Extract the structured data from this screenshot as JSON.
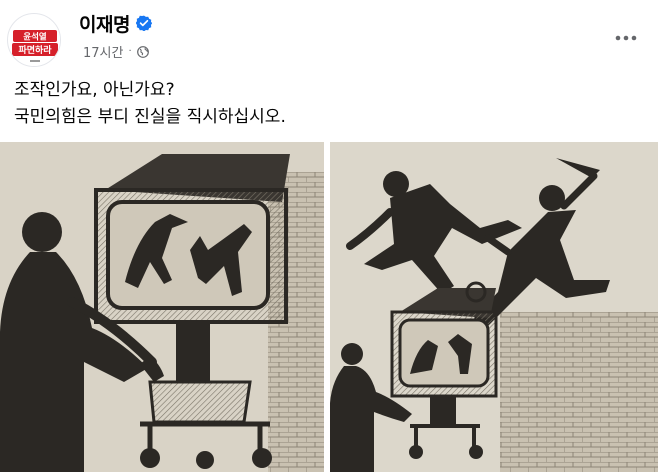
{
  "post": {
    "author": "이재명",
    "time": "17시간",
    "separator": "·",
    "text_lines": [
      "조작인가요, 아닌가요?",
      "국민의힘은 부디 진실을 직시하십시오."
    ],
    "more_icon": "more-horizontal-icon",
    "verified_icon": "verified-badge-icon",
    "privacy_icon": "globe-icon"
  },
  "avatar": {
    "lines": [
      "윤석열",
      "파면하라"
    ],
    "colors": {
      "primary": "#d6202a",
      "background": "#ffffff"
    }
  },
  "colors": {
    "verified": "#1877f2",
    "secondary_text": "#65676b",
    "primary_text": "#050505",
    "illustration_paper": "#d9d3c6",
    "illustration_ink": "#2b2824"
  }
}
